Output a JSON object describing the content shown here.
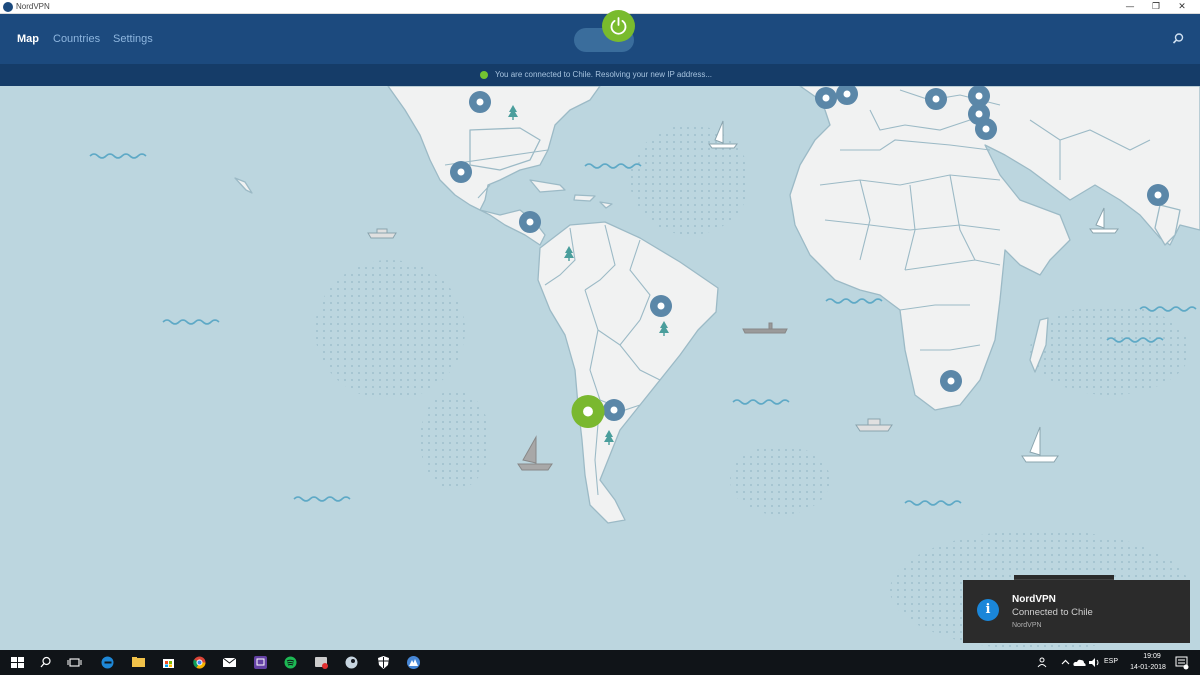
{
  "window": {
    "title": "NordVPN",
    "controls": [
      "—",
      "❐",
      "✕"
    ]
  },
  "nav": {
    "items": [
      {
        "label": "Map",
        "active": true
      },
      {
        "label": "Countries",
        "active": false
      },
      {
        "label": "Settings",
        "active": false
      }
    ]
  },
  "connection": {
    "on": true,
    "status_text": "You are connected to Chile.   Resolving your new IP address..."
  },
  "toast": {
    "title": "NordVPN",
    "message": "Connected to Chile",
    "source": "NordVPN"
  },
  "taskbar": {
    "lang": "ESP",
    "time": "19:09",
    "date": "14-01-2018"
  },
  "colors": {
    "header": "#1c4a7e",
    "statusbar": "#153c68",
    "ocean": "#bcd6df",
    "land": "#f1f2f2",
    "border": "#9cbac6",
    "pin": "#5b87a8",
    "active_pin": "#7ab82f",
    "toggle_on": "#79bb2d"
  },
  "map": {
    "connected_country": "Chile"
  }
}
